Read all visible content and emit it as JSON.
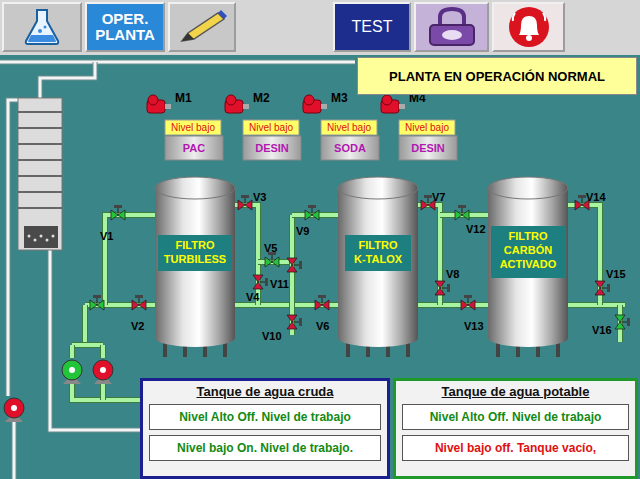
{
  "toolbar": {
    "oper_button": {
      "lines": [
        "OPER.",
        "PLANTA"
      ]
    },
    "test_button": {
      "label": "TEST"
    }
  },
  "status_banner": "PLANTA EN OPERACIÓN NORMAL",
  "dosing": [
    {
      "motor": "M1",
      "level_label": "Nivel bajo",
      "chemical": "PAC",
      "running": false
    },
    {
      "motor": "M2",
      "level_label": "Nivel bajo",
      "chemical": "DESIN",
      "running": false
    },
    {
      "motor": "M3",
      "level_label": "Nivel bajo",
      "chemical": "SODA",
      "running": false
    },
    {
      "motor": "M4",
      "level_label": "Nivel bajo",
      "chemical": "DESIN",
      "running": false
    }
  ],
  "filters": [
    {
      "lines": [
        "FILTRO",
        "TURBILESS"
      ]
    },
    {
      "lines": [
        "FILTRO",
        "K-TALOX"
      ]
    },
    {
      "lines": [
        "FILTRO",
        "CARBÓN",
        "ACTIVADO"
      ]
    }
  ],
  "valves": [
    {
      "label": "V1",
      "open": true
    },
    {
      "label": "V2",
      "open": false
    },
    {
      "label": "V3",
      "open": false
    },
    {
      "label": "V4",
      "open": false
    },
    {
      "label": "V5",
      "open": true
    },
    {
      "label": "V9",
      "open": true
    },
    {
      "label": "V11",
      "open": false
    },
    {
      "label": "V10",
      "open": false
    },
    {
      "label": "V6",
      "open": false
    },
    {
      "label": "V7",
      "open": false
    },
    {
      "label": "V8",
      "open": false
    },
    {
      "label": "V12",
      "open": true
    },
    {
      "label": "V13",
      "open": false
    },
    {
      "label": "V14",
      "open": false
    },
    {
      "label": "V15",
      "open": false
    },
    {
      "label": "V16",
      "open": true
    }
  ],
  "inlet_valve": {
    "open": true
  },
  "pumps": [
    {
      "running": true
    },
    {
      "running": false
    },
    {
      "running": false
    }
  ],
  "tanks": [
    {
      "title": "Tanque de agua cruda",
      "color": "#1c1f8e",
      "rows": [
        {
          "text": "Nivel Alto Off. Nivel de trabajo",
          "alarm": false
        },
        {
          "text": "Nivel bajo On. Nivel de trabajo.",
          "alarm": false
        }
      ]
    },
    {
      "title": "Tanque de agua potable",
      "color": "#1f9a2a",
      "rows": [
        {
          "text": "Nivel Alto Off. Nivel de trabajo",
          "alarm": false
        },
        {
          "text": "Nivel bajo off. Tanque vacío,",
          "alarm": true
        }
      ]
    }
  ]
}
